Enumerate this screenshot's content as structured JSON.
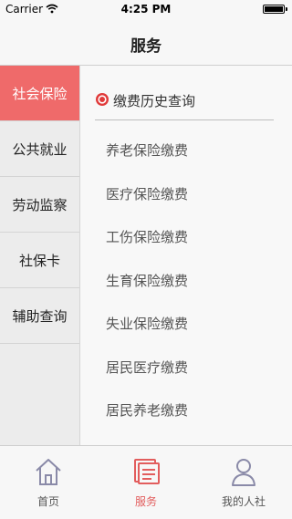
{
  "status_bar": {
    "carrier": "Carrier",
    "time": "4:25 PM"
  },
  "nav": {
    "title": "服务"
  },
  "sidebar": {
    "items": [
      {
        "label": "社会保险",
        "active": true
      },
      {
        "label": "公共就业"
      },
      {
        "label": "劳动监察"
      },
      {
        "label": "社保卡"
      },
      {
        "label": "辅助查询"
      }
    ]
  },
  "main": {
    "section_title": "缴费历史查询",
    "items": [
      "养老保险缴费",
      "医疗保险缴费",
      "工伤保险缴费",
      "生育保险缴费",
      "失业保险缴费",
      "居民医疗缴费",
      "居民养老缴费"
    ]
  },
  "tabs": [
    {
      "label": "首页",
      "icon": "home-icon"
    },
    {
      "label": "服务",
      "icon": "service-icon",
      "active": true
    },
    {
      "label": "我的人社",
      "icon": "user-icon"
    }
  ],
  "colors": {
    "accent": "#ef6a6a",
    "tab_active": "#e25d5d",
    "icon_gray": "#8a8aa8"
  }
}
